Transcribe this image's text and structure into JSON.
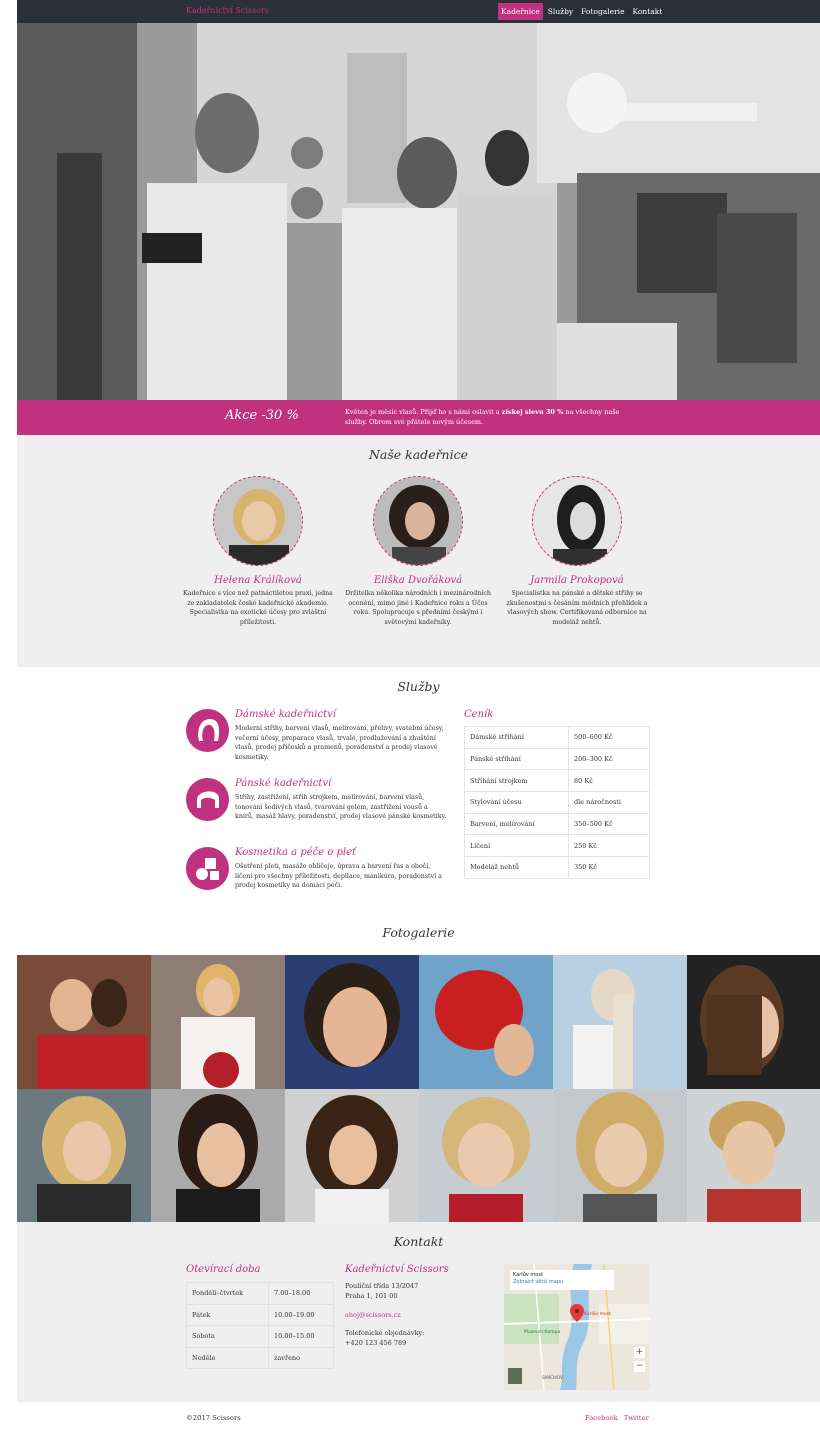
{
  "nav": {
    "brand": "Kadeřnictví Scissors",
    "links": [
      "Kadeřnice",
      "Služby",
      "Fotogalerie",
      "Kontakt"
    ]
  },
  "promo": {
    "title": "Akce -30 %",
    "text_before": "Květen je měsíc vlasů. Přijď ho s námi oslavit a ",
    "text_bold": "získej slevu 30 %",
    "text_after": " na všechny naše služby. Obrom své přátele novým účesem."
  },
  "team": {
    "title": "Naše kadeřnice",
    "members": [
      {
        "name": "Helena Králíková",
        "desc": "Kadeřnice s více než patnáctiletou praxí, jedna ze zakladatelek české kadeřnické akademie. Specialistka na exotické účesy pro zvláštní příležitosti."
      },
      {
        "name": "Eliška Dvořáková",
        "desc": "Držitelka několika národních i mezinárodních ocenění, mimo jiné i Kadeřnice roku a Účes roku. Spolupracuje s předními českými i světovými kadeřníky."
      },
      {
        "name": "Jarmila Prokopová",
        "desc": "Specialistka na pánské a dětské střihy se zkušenostmi s česáním módních přehlídek a vlasových show. Certifikovaná odbornice na modeláž nehtů."
      }
    ]
  },
  "services": {
    "title": "Služby",
    "items": [
      {
        "title": "Dámské kadeřnictví",
        "desc": "Moderní střihy, barvení vlasů, melírování, přelivy, svatební účesy, večerní účesy, preparace vlasů, trvalé, prodlužování a zhuštění vlasů, prodej příčesků a pramenů, poradenství a prodej vlasové kosmetiky.",
        "icon": "woman-hair-icon"
      },
      {
        "title": "Pánské kadeřnictví",
        "desc": "Střihy, zastřižení, střih strojkem, melírování, barvení vlasů, tonování šedivých vlasů, tvarování gelem, zastřižení vousů a knírů, masáž hlavy, poradenství, prodej vlasové pánské kosmetiky.",
        "icon": "man-hair-icon"
      },
      {
        "title": "Kosmetika a péče o pleť",
        "desc": "Ošetření pleti, masáže obličeje, úprava a barvení řas a obočí, líčení pro všechny příležitosti, depilace, manikúra, poradenství a prodej kosmetiky na domácí péči.",
        "icon": "cosmetics-icon"
      }
    ],
    "price_title": "Ceník",
    "prices": [
      [
        "Dámské stříhání",
        "500–600 Kč"
      ],
      [
        "Pánské stříhání",
        "200–300 Kč"
      ],
      [
        "Stříhání strojkem",
        "80 Kč"
      ],
      [
        "Stylování účesu",
        "dle náročnosti"
      ],
      [
        "Barvení, melírování",
        "350–500 Kč"
      ],
      [
        "Líčení",
        "250 Kč"
      ],
      [
        "Modeláž nehtů",
        "350 Kč"
      ]
    ]
  },
  "gallery": {
    "title": "Fotogalerie"
  },
  "contact": {
    "title": "Kontakt",
    "hours_title": "Otevírací doba",
    "hours": [
      [
        "Pondělí–čtvrtek",
        "7.00–18.00"
      ],
      [
        "Pátek",
        "10.00–19.00"
      ],
      [
        "Sobota",
        "10.00–15.00"
      ],
      [
        "Neděle",
        "zavřeno"
      ]
    ],
    "company": "Kadeřnictví Scissors",
    "street": "Poulíční třída 13/2047",
    "city": "Praha 1, 101 00",
    "email": "ahoj@scissors.cz",
    "phone_label": "Telefonické objednávky:",
    "phone": "+420 123 456 789",
    "map": {
      "place": "Karlův most",
      "link": "Zobrazit větší mapu",
      "label_marker": "Karlův most",
      "label_kampa": "Muzeum Kampa",
      "label_smichov": "SMÍCHOV"
    }
  },
  "footer": {
    "copy": "©2017 Scissors",
    "links": [
      "Facebook",
      "Twitter"
    ]
  },
  "colors": {
    "accent": "#c0327f",
    "nav_bg": "#2b2f38",
    "section_bg": "#efefef"
  }
}
